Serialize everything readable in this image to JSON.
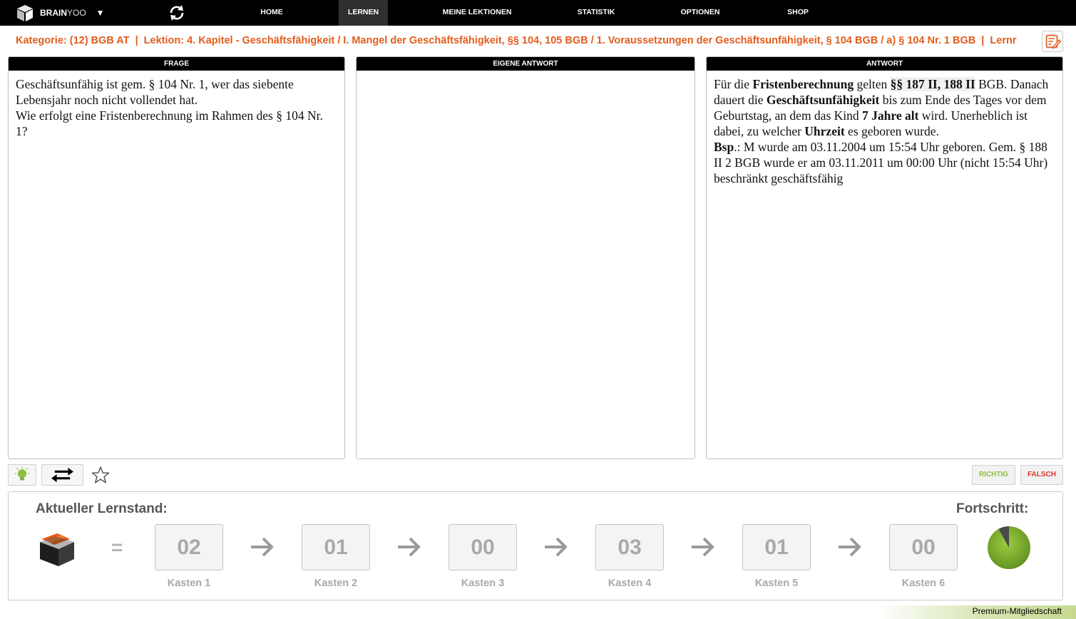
{
  "nav": {
    "brand_bold": "BRAIN",
    "brand_light": "YOO",
    "items": [
      {
        "label": "HOME"
      },
      {
        "label": "LERNEN"
      },
      {
        "label": "MEINE LEKTIONEN"
      },
      {
        "label": "STATISTIK"
      },
      {
        "label": "OPTIONEN"
      },
      {
        "label": "SHOP"
      }
    ],
    "active_item": "LERNEN"
  },
  "breadcrumb": "Kategorie: (12) BGB AT  |  Lektion: 4. Kapitel - Geschäftsfähigkeit / I. Mangel der Geschäftsfähigkeit, §§ 104, 105 BGB / 1. Voraussetzungen der Geschäftsunfähigkeit, § 104 BGB / a) § 104 Nr. 1 BGB  |  Lernr",
  "panels": {
    "frage": {
      "title": "FRAGE",
      "line1": "Geschäftsunfähig ist gem. § 104 Nr. 1, wer das siebente Lebensjahr noch nicht vollendet hat.",
      "line2": "Wie erfolgt eine Fristenberechnung im Rahmen des § 104 Nr. 1?"
    },
    "eigene": {
      "title": "EIGENE ANTWORT",
      "value": ""
    },
    "antwort": {
      "title": "ANTWORT",
      "s1": "Für die ",
      "b1": "Fristenberechnung",
      "s2": " gelten ",
      "b2": "§§ 187 II, 188 II",
      "s3": " BGB. Danach dauert die ",
      "b3": "Geschäftsunfähigkeit",
      "s4": " bis zum Ende des Tages vor dem Geburtstag, an dem das Kind ",
      "b4": "7 Jahre alt",
      "s5": " wird. Unerheblich ist dabei, zu welcher ",
      "b5": "Uhrzeit",
      "s6": " es geboren wurde.",
      "b6": "Bsp",
      "s7": ".: M wurde am 03.11.2004 um 15:54 Uhr geboren. Gem. § 188 II 2 BGB wurde er am 03.11.2011 um 00:00 Uhr (nicht 15:54 Uhr) beschränkt geschäftsfähig"
    }
  },
  "actions": {
    "richtig": "RICHTIG",
    "falsch": "FALSCH",
    "richtig_color": "#8cbf3f",
    "falsch_color": "#d9342b"
  },
  "progress": {
    "title": "Aktueller Lernstand:",
    "equals": "=",
    "fortschritt_title": "Fortschritt:",
    "fortschritt_fraction": 0.92,
    "boxes": [
      {
        "value": "02",
        "label": "Kasten 1"
      },
      {
        "value": "01",
        "label": "Kasten 2"
      },
      {
        "value": "00",
        "label": "Kasten 3"
      },
      {
        "value": "03",
        "label": "Kasten 4"
      },
      {
        "value": "01",
        "label": "Kasten 5"
      },
      {
        "value": "00",
        "label": "Kasten 6"
      }
    ]
  },
  "footer": {
    "premium": "Premium-Mitgliedschaft"
  }
}
